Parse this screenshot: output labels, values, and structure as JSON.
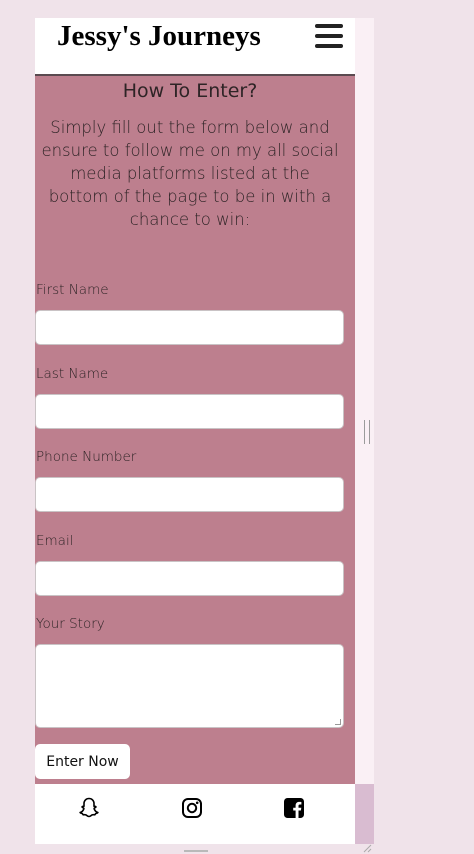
{
  "header": {
    "brand": "Jessy's Journeys",
    "menu_icon": "hamburger-menu-icon"
  },
  "intro": {
    "heading": "How To Enter?",
    "text": "Simply fill out the form below and ensure to follow me on my all social media platforms listed at the bottom of the page to be in with a chance to win:"
  },
  "form": {
    "first_name_label": "First Name",
    "first_name_value": "",
    "last_name_label": "Last Name",
    "last_name_value": "",
    "phone_label": "Phone Number",
    "phone_value": "",
    "email_label": "Email",
    "email_value": "",
    "story_label": "Your Story",
    "story_value": "",
    "submit_label": "Enter Now"
  },
  "footer": {
    "icons": [
      "snapchat-icon",
      "instagram-icon",
      "facebook-icon"
    ]
  },
  "colors": {
    "page_background": "#f0e3ea",
    "content_background": "#bd7f8e",
    "header_background": "#ffffff"
  }
}
